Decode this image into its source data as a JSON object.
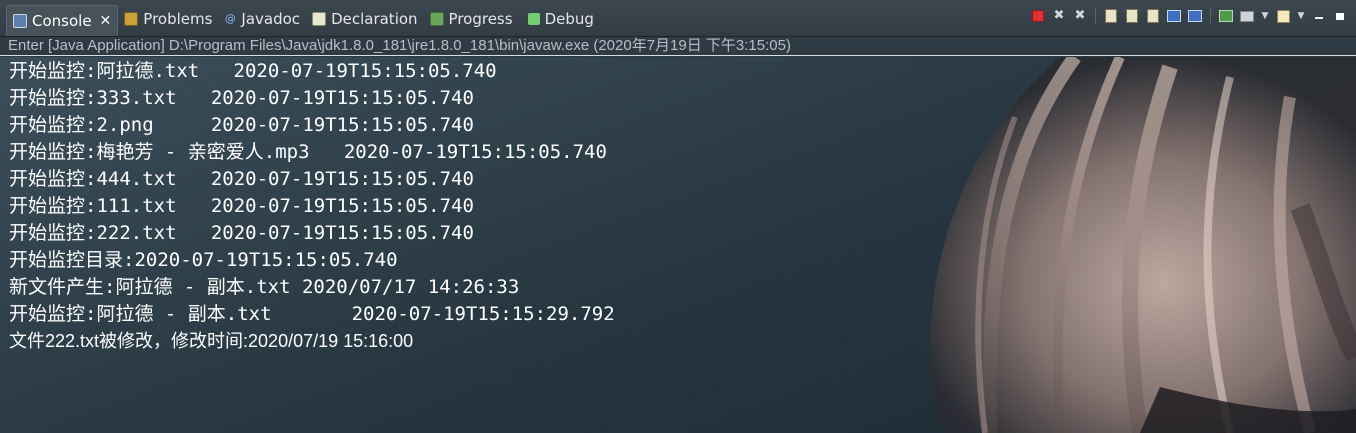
{
  "tabs": [
    {
      "label": "Console",
      "icon": "console-icon",
      "active": true
    },
    {
      "label": "Problems",
      "icon": "problems-icon"
    },
    {
      "label": "Javadoc",
      "icon": "javadoc-icon"
    },
    {
      "label": "Declaration",
      "icon": "declaration-icon"
    },
    {
      "label": "Progress",
      "icon": "progress-icon"
    },
    {
      "label": "Debug",
      "icon": "debug-icon"
    }
  ],
  "close_glyph": "✕",
  "status": {
    "text": "Enter [Java Application] D:\\Program Files\\Java\\jdk1.8.0_181\\jre1.8.0_181\\bin\\javaw.exe (2020年7月19日 下午3:15:05)"
  },
  "console_lines": [
    "开始监控:阿拉德.txt   2020-07-19T15:15:05.740",
    "开始监控:333.txt   2020-07-19T15:15:05.740",
    "开始监控:2.png     2020-07-19T15:15:05.740",
    "开始监控:梅艳芳 - 亲密爱人.mp3   2020-07-19T15:15:05.740",
    "开始监控:444.txt   2020-07-19T15:15:05.740",
    "开始监控:111.txt   2020-07-19T15:15:05.740",
    "开始监控:222.txt   2020-07-19T15:15:05.740",
    "开始监控目录:2020-07-19T15:15:05.740",
    "新文件产生:阿拉德 - 副本.txt 2020/07/17 14:26:33",
    "开始监控:阿拉德 - 副本.txt       2020-07-19T15:15:29.792",
    "文件222.txt被修改，修改时间:2020/07/19 15:16:00"
  ],
  "colors": {
    "terminate": "#e03232",
    "console_text": "#ffffff",
    "status_text": "#b7bfc6"
  }
}
